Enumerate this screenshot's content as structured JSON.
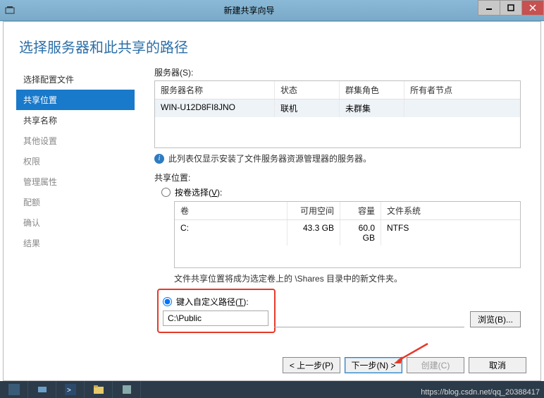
{
  "titlebar": {
    "title": "新建共享向导"
  },
  "heading": "选择服务器和此共享的路径",
  "sidebar": {
    "items": [
      {
        "label": "选择配置文件",
        "state": "done"
      },
      {
        "label": "共享位置",
        "state": "active"
      },
      {
        "label": "共享名称",
        "state": "done"
      },
      {
        "label": "其他设置",
        "state": "disabled"
      },
      {
        "label": "权限",
        "state": "disabled"
      },
      {
        "label": "管理属性",
        "state": "disabled"
      },
      {
        "label": "配额",
        "state": "disabled"
      },
      {
        "label": "确认",
        "state": "disabled"
      },
      {
        "label": "结果",
        "state": "disabled"
      }
    ]
  },
  "servers": {
    "label": "服务器(S):",
    "columns": {
      "name": "服务器名称",
      "status": "状态",
      "role": "群集角色",
      "owner": "所有者节点"
    },
    "rows": [
      {
        "name": "WIN-U12D8FI8JNO",
        "status": "联机",
        "role": "未群集",
        "owner": ""
      }
    ]
  },
  "info_note": "此列表仅显示安装了文件服务器资源管理器的服务器。",
  "share_location": {
    "label": "共享位置:",
    "by_volume": {
      "label_prefix": "按卷选择(",
      "hotkey": "V",
      "label_suffix": "):"
    },
    "volumes": {
      "columns": {
        "vol": "卷",
        "free": "可用空间",
        "cap": "容量",
        "fs": "文件系统"
      },
      "rows": [
        {
          "vol": "C:",
          "free": "43.3 GB",
          "cap": "60.0 GB",
          "fs": "NTFS"
        }
      ]
    },
    "note": "文件共享位置将成为选定卷上的 \\Shares 目录中的新文件夹。",
    "custom": {
      "label_prefix": "键入自定义路径(",
      "hotkey": "T",
      "label_suffix": "):",
      "value": "C:\\Public"
    },
    "browse": "浏览(B)..."
  },
  "buttons": {
    "prev": "< 上一步(P)",
    "next": "下一步(N) >",
    "create": "创建(C)",
    "cancel": "取消"
  },
  "watermark": "https://blog.csdn.net/qq_20388417"
}
